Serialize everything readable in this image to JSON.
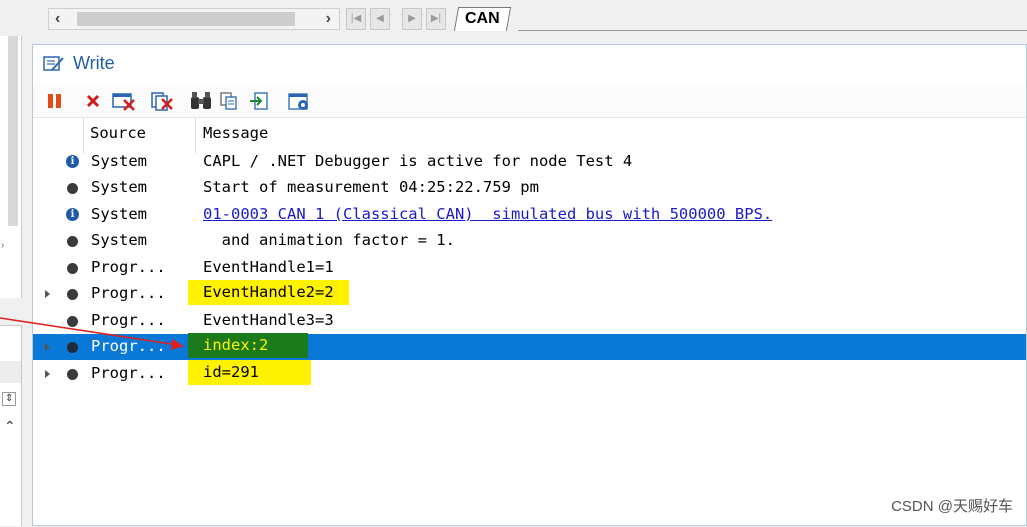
{
  "tabs": {
    "active": "CAN"
  },
  "write_window": {
    "title": "Write",
    "columns": {
      "source": "Source",
      "message": "Message"
    },
    "rows": [
      {
        "icon": "info-icon",
        "source": "System",
        "message": "CAPL / .NET Debugger is active for node Test 4",
        "style": "normal"
      },
      {
        "icon": "dot-icon",
        "source": "System",
        "message": "Start of measurement 04:25:22.759 pm",
        "style": "normal"
      },
      {
        "icon": "info-icon",
        "source": "System",
        "message": "01-0003 CAN 1 (Classical CAN)  simulated bus with 500000 BPS.",
        "style": "link"
      },
      {
        "icon": "dot-icon",
        "source": "System",
        "message": "  and animation factor = 1.",
        "style": "normal"
      },
      {
        "icon": "dot-icon",
        "source": "Progr...",
        "message": "EventHandle1=1",
        "style": "normal"
      },
      {
        "icon": "dot-icon",
        "source": "Progr...",
        "message": "EventHandle2=2",
        "style": "highlight"
      },
      {
        "icon": "dot-icon",
        "source": "Progr...",
        "message": "EventHandle3=3",
        "style": "normal"
      },
      {
        "icon": "dot-icon",
        "source": "Progr...",
        "message": "index:2",
        "style": "selected"
      },
      {
        "icon": "dot-icon",
        "source": "Progr...",
        "message": "id=291",
        "style": "highlight"
      }
    ]
  },
  "watermark": "CSDN @天赐好车",
  "colors": {
    "selection": "#0a78d7",
    "highlight": "#fff200",
    "link": "#1a1acc",
    "arrow": "#e02020"
  }
}
